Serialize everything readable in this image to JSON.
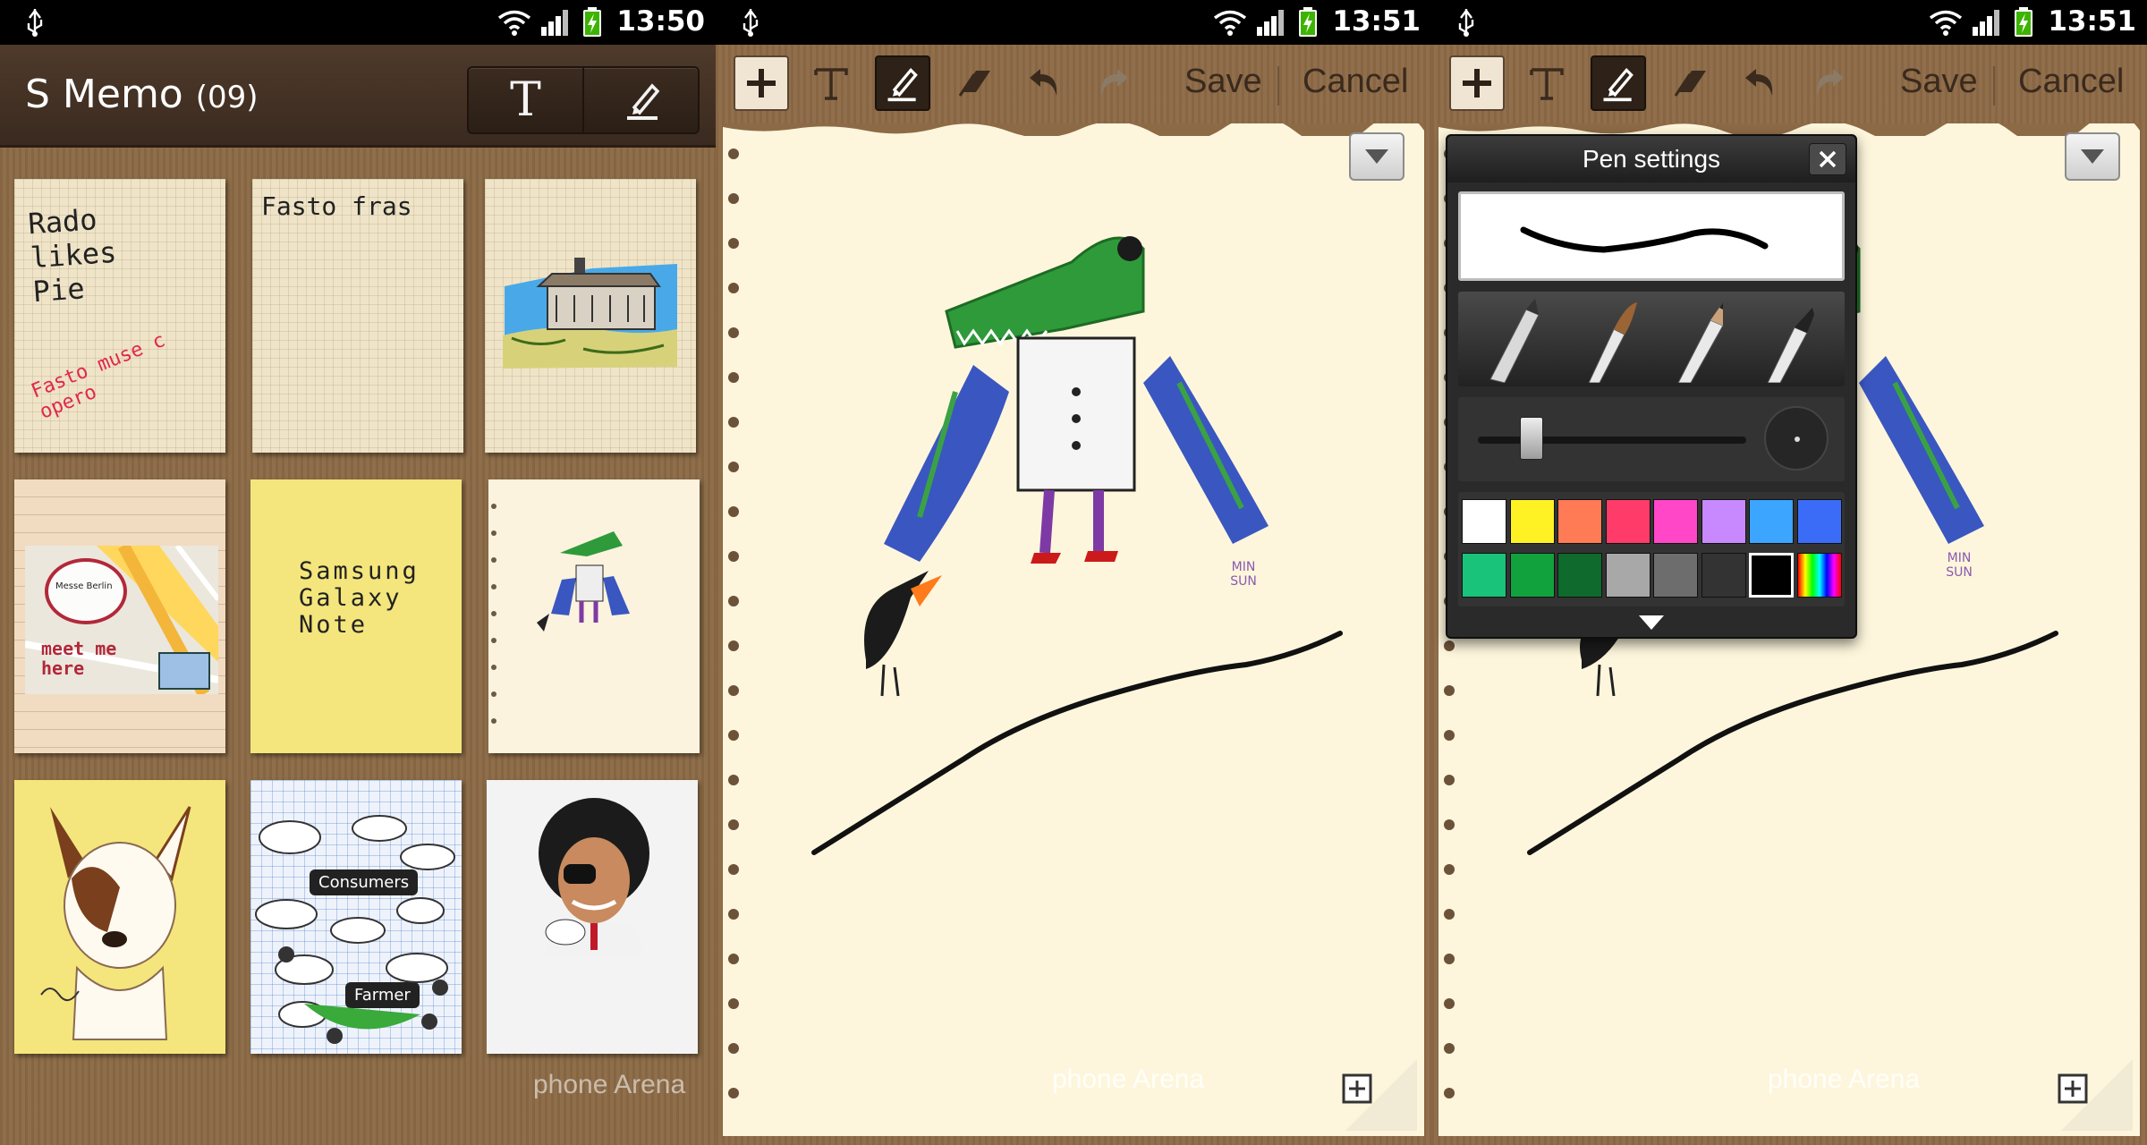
{
  "screens": [
    {
      "status": {
        "time": "13:50"
      },
      "app": {
        "title": "S Memo",
        "count": "(09)",
        "text_button": "T"
      },
      "notes": [
        {
          "type": "handwritten",
          "lines": [
            "Rado",
            "likes",
            "Pie"
          ],
          "extra": "Fasto muse c opero"
        },
        {
          "type": "handwritten",
          "lines": [
            "Fasto fras"
          ]
        },
        {
          "type": "sketch-castle"
        },
        {
          "type": "map",
          "map_label": "Messe Berlin",
          "note": "meet me here"
        },
        {
          "type": "typed",
          "text": "Samsung\nGalaxy\nNote"
        },
        {
          "type": "sketch-crocodile"
        },
        {
          "type": "sketch-dog"
        },
        {
          "type": "mindmap",
          "center": "Consumers",
          "bottom": "Farmer"
        },
        {
          "type": "photo-face"
        }
      ],
      "watermark": "phone Arena"
    },
    {
      "status": {
        "time": "13:51"
      },
      "toolbar": {
        "save": "Save",
        "cancel": "Cancel"
      },
      "artist_tag": "MIN SUN",
      "watermark": "phone Arena"
    },
    {
      "status": {
        "time": "13:51"
      },
      "toolbar": {
        "save": "Save",
        "cancel": "Cancel"
      },
      "popup": {
        "title": "Pen settings",
        "pens": [
          "fountain-pen-icon",
          "brush-icon",
          "pencil-icon",
          "marker-icon"
        ],
        "thickness_fraction": 0.2,
        "colors": [
          "#ffffff",
          "#fff224",
          "#ff7b55",
          "#ff3b6a",
          "#ff47c8",
          "#c889ff",
          "#3ba5ff",
          "#3a6cf7",
          "#19c37a",
          "#11a23d",
          "#0e6a2d",
          "#a8a8a8",
          "#6d6d6d",
          "#333333",
          "#000000",
          "rainbow"
        ],
        "selected_color": "#000000"
      },
      "artist_tag": "MIN SUN",
      "watermark": "phone Arena"
    }
  ]
}
